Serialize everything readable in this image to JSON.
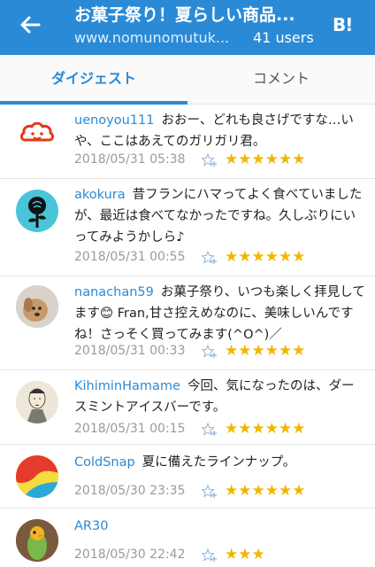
{
  "appbar": {
    "title": "お菓子祭り！夏らしい商品...",
    "url": "www.nomunomutuk...",
    "users": "41 users",
    "hatena_badge": "B!",
    "color": "#2a8ad6"
  },
  "tabs": [
    {
      "label": "ダイジェスト",
      "active": true
    },
    {
      "label": "コメント",
      "active": false
    }
  ],
  "comments": [
    {
      "user": "uenoyou111",
      "text": "おおー、どれも良さげですな…いや、ここはあえてのガリガリ君。",
      "date": "2018/05/31 05:38",
      "stars": "★★★★★★",
      "star_count": 6,
      "avatar": "red-face-icon"
    },
    {
      "user": "akokura",
      "text": "昔フランにハマってよく食べていましたが、最近は食べてなかったですね。久しぶりにいってみようかしら♪",
      "date": "2018/05/31 00:55",
      "stars": "★★★★★★",
      "star_count": 6,
      "avatar": "rose-icon"
    },
    {
      "user": "nanachan59",
      "text": "お菓子祭り、いつも楽しく拝見してます😊 Fran,甘さ控えめなのに、美味しいんですね！さっそく買ってみます(^O^)／",
      "date": "2018/05/31 00:33",
      "stars": "★★★★★★",
      "star_count": 6,
      "avatar": "dog-photo"
    },
    {
      "user": "KihiminHamame",
      "text": "今回、気になったのは、ダースミントアイスバーです。",
      "date": "2018/05/31 00:15",
      "stars": "★★★★★★",
      "star_count": 6,
      "avatar": "ukiyoe-portrait"
    },
    {
      "user": "ColdSnap",
      "text": "夏に備えたラインナップ。",
      "date": "2018/05/30 23:35",
      "stars": "★★★★★★",
      "star_count": 6,
      "avatar": "colorful-circle"
    },
    {
      "user": "AR30",
      "text": "",
      "date": "2018/05/30 22:42",
      "stars": "★★★",
      "star_count": 3,
      "avatar": "bird-photo"
    }
  ]
}
